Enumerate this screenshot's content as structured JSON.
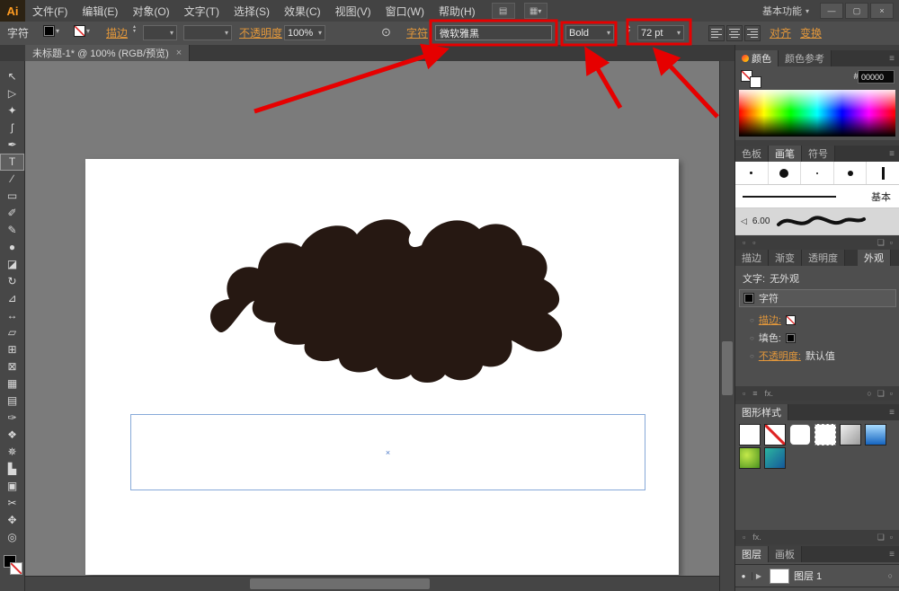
{
  "titlebar": {
    "logo": "Ai",
    "menus": [
      "文件(F)",
      "编辑(E)",
      "对象(O)",
      "文字(T)",
      "选择(S)",
      "效果(C)",
      "视图(V)",
      "窗口(W)",
      "帮助(H)"
    ],
    "workspace": "基本功能"
  },
  "window_controls": {
    "minimize": "—",
    "maximize": "▢",
    "close": "×"
  },
  "controlbar": {
    "label": "字符",
    "stroke_label": "描边",
    "opacity_label": "不透明度",
    "opacity_value": "100%",
    "character_label": "字符",
    "font_name": "微软雅黑",
    "font_style": "Bold",
    "font_size": "72 pt",
    "align_label": "对齐",
    "transform_label": "变换"
  },
  "doc_tab": {
    "title": "未标题-1* @ 100% (RGB/预览)",
    "close": "×"
  },
  "tools": [
    {
      "name": "selection",
      "glyph": "↖"
    },
    {
      "name": "direct-selection",
      "glyph": "▷"
    },
    {
      "name": "magic-wand",
      "glyph": "✦"
    },
    {
      "name": "lasso",
      "glyph": "ʃ"
    },
    {
      "name": "pen",
      "glyph": "✒"
    },
    {
      "name": "type",
      "glyph": "T"
    },
    {
      "name": "line-segment",
      "glyph": "∕"
    },
    {
      "name": "rectangle",
      "glyph": "▭"
    },
    {
      "name": "paintbrush",
      "glyph": "✐"
    },
    {
      "name": "pencil",
      "glyph": "✎"
    },
    {
      "name": "blob-brush",
      "glyph": "●"
    },
    {
      "name": "eraser",
      "glyph": "◪"
    },
    {
      "name": "rotate",
      "glyph": "↻"
    },
    {
      "name": "scale",
      "glyph": "⊿"
    },
    {
      "name": "width",
      "glyph": "↔"
    },
    {
      "name": "free-transform",
      "glyph": "▱"
    },
    {
      "name": "shape-builder",
      "glyph": "⊞"
    },
    {
      "name": "perspective-grid",
      "glyph": "⊠"
    },
    {
      "name": "mesh",
      "glyph": "▦"
    },
    {
      "name": "gradient",
      "glyph": "▤"
    },
    {
      "name": "eyedropper",
      "glyph": "✑"
    },
    {
      "name": "blend",
      "glyph": "❖"
    },
    {
      "name": "symbol-sprayer",
      "glyph": "✵"
    },
    {
      "name": "column-graph",
      "glyph": "▙"
    },
    {
      "name": "artboard",
      "glyph": "▣"
    },
    {
      "name": "slice",
      "glyph": "✂"
    },
    {
      "name": "hand",
      "glyph": "✥"
    },
    {
      "name": "zoom",
      "glyph": "◎"
    }
  ],
  "canvas": {
    "cursor_marker": "×"
  },
  "panels": {
    "color": {
      "tab": "颜色",
      "guide_tab": "颜色参考",
      "hex_label": "#",
      "hex_value": "00000"
    },
    "brushes": {
      "tabs": [
        "色板",
        "画笔",
        "符号"
      ],
      "basic_label": "基本",
      "stroke_size": "6.00"
    },
    "appearance": {
      "tabs": [
        "描边",
        "渐变",
        "透明度"
      ],
      "active_tab": "外观",
      "type_label": "文字:",
      "type_value": "无外观",
      "char_row": "字符",
      "stroke_row": "描边:",
      "fill_row": "填色:",
      "opacity_row": "不透明度:",
      "opacity_value": "默认值"
    },
    "graphic_styles": {
      "tab": "图形样式"
    },
    "layers": {
      "tabs": [
        "图层",
        "画板"
      ],
      "layer_name": "图层 1"
    }
  },
  "icons": {
    "dropdown": "▾",
    "spin_up": "▴",
    "spin_down": "▾",
    "menu": "≡",
    "recolor": "⊙",
    "arrange": "▤",
    "layout": "▦",
    "eye": "●",
    "expand": "▶",
    "fx": "fx.",
    "new": "❏",
    "square": "▫",
    "circle": "○",
    "speaker": "◁"
  }
}
